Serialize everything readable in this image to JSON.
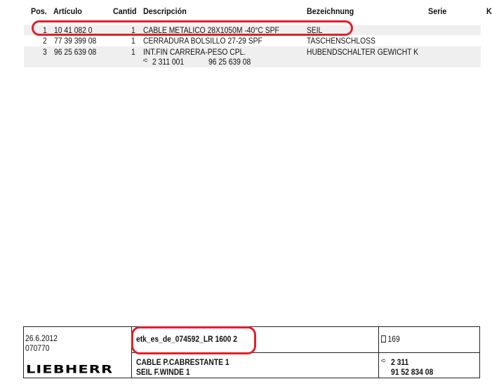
{
  "headers": {
    "pos": "Pos.",
    "articulo": "Artículo",
    "cantid": "Cantid",
    "descripcion": "Descripción",
    "bezeichnung": "Bezeichnung",
    "serie": "Serie",
    "k": "K"
  },
  "rows": [
    {
      "pos": "1",
      "articulo": "10 41 082 0",
      "cantid": "1",
      "descripcion": "CABLE METALICO 28X1050M -40°C SPF",
      "bezeichnung": "SEIL"
    },
    {
      "pos": "2",
      "articulo": "77 39 399 08",
      "cantid": "1",
      "descripcion": "CERRADURA BOLSILLO 27-29 SPF",
      "bezeichnung": "TASCHENSCHLOSS"
    },
    {
      "pos": "3",
      "articulo": "96 25 639 08",
      "cantid": "1",
      "descripcion": "INT.FIN CARRERA-PESO CPL.",
      "bezeichnung": "HUBENDSCHALTER GEWICHT K"
    }
  ],
  "row3_ref": {
    "arrow": "➪",
    "ref": "2 311 001",
    "part": "96 25 639 08"
  },
  "footer": {
    "date": "26.6.2012",
    "code": "070770",
    "document_id": "etk_es_de_074592_LR 1600 2",
    "page_number": "169",
    "title_es": "CABLE P.CABRESTANTE 1",
    "title_de": "SEIL F.WINDE 1",
    "ref_arrow": "➪",
    "ref_number": "2 311",
    "part_number": "91 52 834 08",
    "logo": "LIEBHERR"
  },
  "colors": {
    "highlight": "#e0202a",
    "row_gray": "#efefef"
  }
}
